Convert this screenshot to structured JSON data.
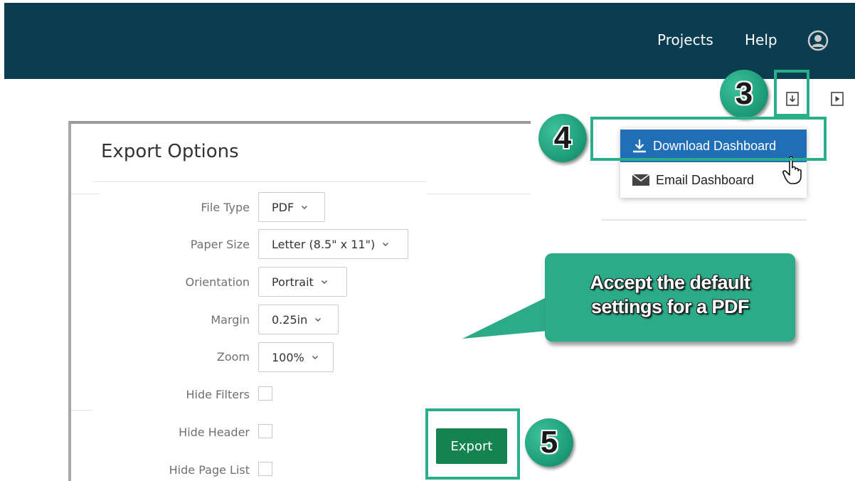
{
  "header": {
    "nav": [
      {
        "label": "Projects"
      },
      {
        "label": "Help"
      }
    ],
    "user_icon": "user-circle-icon",
    "background": "#0b3d51"
  },
  "toolbar": {
    "icons": [
      "download-file-icon",
      "play-icon"
    ]
  },
  "callouts": {
    "step3": "3",
    "step4": "4",
    "step5": "5",
    "accent": "#2bae8a",
    "bubble_line1": "Accept the default",
    "bubble_line2": "settings for a PDF"
  },
  "menu": {
    "items": [
      {
        "label": "Download Dashboard",
        "icon": "download-icon",
        "active": true
      },
      {
        "label": "Email Dashboard",
        "icon": "envelope-icon",
        "active": false
      }
    ],
    "active_color": "#1f6eb6"
  },
  "export_options": {
    "title": "Export Options",
    "fields": [
      {
        "label": "File Type",
        "value": "PDF"
      },
      {
        "label": "Paper Size",
        "value": "Letter (8.5\" x 11\")"
      },
      {
        "label": "Orientation",
        "value": "Portrait"
      },
      {
        "label": "Margin",
        "value": "0.25in"
      },
      {
        "label": "Zoom",
        "value": "100%"
      }
    ],
    "checkboxes": [
      {
        "label": "Hide Filters",
        "checked": false
      },
      {
        "label": "Hide Header",
        "checked": false
      },
      {
        "label": "Hide Page List",
        "checked": false
      }
    ],
    "export_label": "Export",
    "export_color": "#14834f"
  }
}
